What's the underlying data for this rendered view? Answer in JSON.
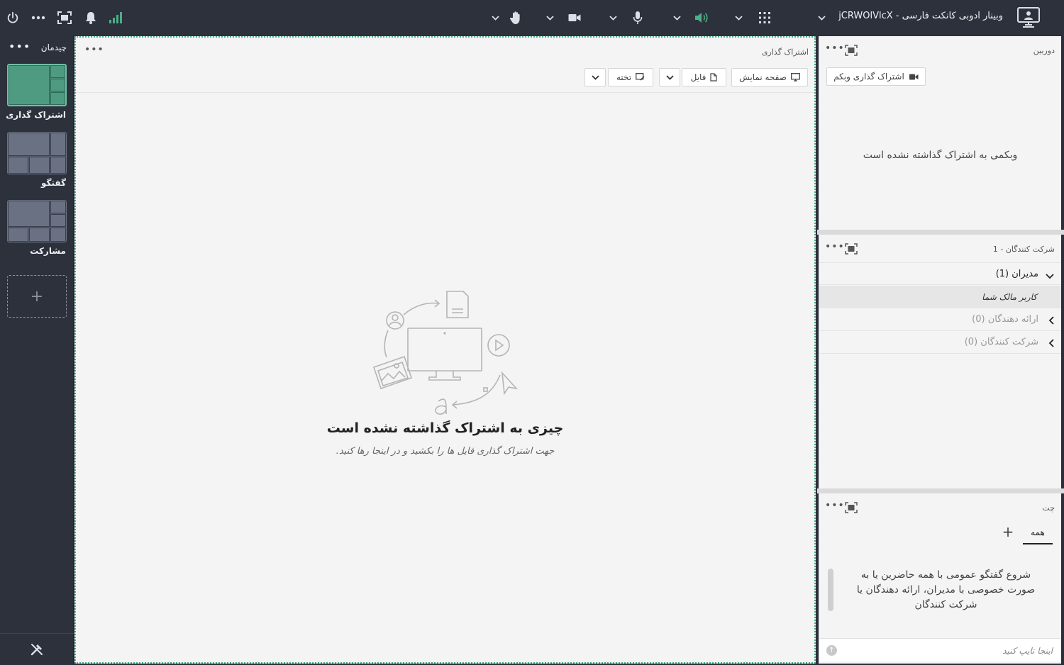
{
  "topbar": {
    "meeting_title": "وبینار ادوبی کانکت فارسی - jCRWOlVlcX"
  },
  "layouts_panel": {
    "title": "چیدمان",
    "items": [
      {
        "label": "اشتراک گذاری",
        "active": true
      },
      {
        "label": "گفتگو",
        "active": false
      },
      {
        "label": "مشارکت",
        "active": false
      }
    ],
    "add_label": "+"
  },
  "share_pod": {
    "title": "اشتراک گذاری",
    "buttons": {
      "screen": "صفحه نمایش",
      "file": "فایل",
      "whiteboard": "تخته"
    },
    "empty_title": "چیزی به اشتراک گذاشته نشده است",
    "empty_subtitle": "جهت اشتراک گذاری فایل ها را بکشید و در اینجا رها کنید."
  },
  "camera_pod": {
    "title": "دوربین",
    "share_webcam": "اشتراک گذاری وبکم",
    "message": "وبکمی به اشتراک گذاشته نشده است"
  },
  "participants_pod": {
    "title": "شرکت کنندگان - 1",
    "groups": [
      {
        "label": "مدیران (1)",
        "expanded": true
      },
      {
        "label": "ارائه دهندگان (0)",
        "expanded": false
      },
      {
        "label": "شرکت کنندگان (0)",
        "expanded": false
      }
    ],
    "current_user": "کاربر مالک شما"
  },
  "chat_pod": {
    "title": "چت",
    "tab_all": "همه",
    "message": "شروع گفتگو عمومی با همه حاضرین یا به صورت خصوصی با مدیران، ارائه دهندگان یا شرکت کنندگان",
    "input_placeholder": "اینجا تایپ کنید"
  },
  "colors": {
    "bar_bg": "#2c313c",
    "accent_green": "#4caf85",
    "pod_bg": "#f4f4f4"
  },
  "icons": [
    "power-icon",
    "more-icon",
    "fullscreen-icon",
    "bell-icon",
    "signal-icon",
    "hand-raise-icon",
    "camera-icon",
    "mic-icon",
    "speaker-icon",
    "apps-grid-icon",
    "meeting-monitor-icon",
    "tools-icon"
  ]
}
